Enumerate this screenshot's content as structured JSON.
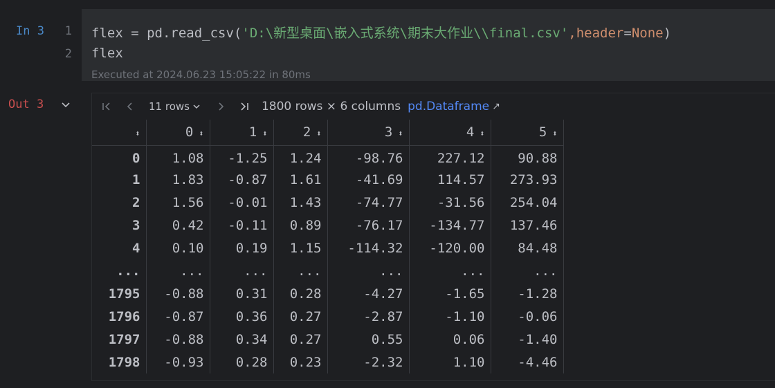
{
  "input": {
    "prompt": "In 3",
    "line_numbers": [
      "1",
      "2"
    ],
    "line1": {
      "var": "flex",
      "op": " = ",
      "call": "pd.read_csv(",
      "path": "'D:\\新型桌面\\嵌入式系统\\期末大作业\\\\final.csv'",
      "comma": ",",
      "kwarg": "header",
      "eq": "=",
      "kwval": "None",
      "close": ")"
    },
    "line2": "flex",
    "executed": "Executed at 2024.06.23 15:05:22 in 80ms"
  },
  "output": {
    "prompt": "Out 3",
    "toolbar": {
      "rows_label": "11 rows",
      "shape": "1800 rows × 6 columns",
      "link": "pd.Dataframe",
      "link_arrow": "↗"
    },
    "columns": [
      "",
      "0",
      "1",
      "2",
      "3",
      "4",
      "5"
    ],
    "rows": [
      [
        "0",
        "1.08",
        "-1.25",
        "1.24",
        "-98.76",
        "227.12",
        "90.88"
      ],
      [
        "1",
        "1.83",
        "-0.87",
        "1.61",
        "-41.69",
        "114.57",
        "273.93"
      ],
      [
        "2",
        "1.56",
        "-0.01",
        "1.43",
        "-74.77",
        "-31.56",
        "254.04"
      ],
      [
        "3",
        "0.42",
        "-0.11",
        "0.89",
        "-76.17",
        "-134.77",
        "137.46"
      ],
      [
        "4",
        "0.10",
        "0.19",
        "1.15",
        "-114.32",
        "-120.00",
        "84.48"
      ],
      [
        "...",
        "...",
        "...",
        "...",
        "...",
        "...",
        "..."
      ],
      [
        "1795",
        "-0.88",
        "0.31",
        "0.28",
        "-4.27",
        "-1.65",
        "-1.28"
      ],
      [
        "1796",
        "-0.87",
        "0.36",
        "0.27",
        "-2.87",
        "-1.10",
        "-0.06"
      ],
      [
        "1797",
        "-0.88",
        "0.34",
        "0.27",
        "0.55",
        "0.06",
        "-1.40"
      ],
      [
        "1798",
        "-0.93",
        "0.28",
        "0.23",
        "-2.32",
        "1.10",
        "-4.46"
      ]
    ]
  }
}
